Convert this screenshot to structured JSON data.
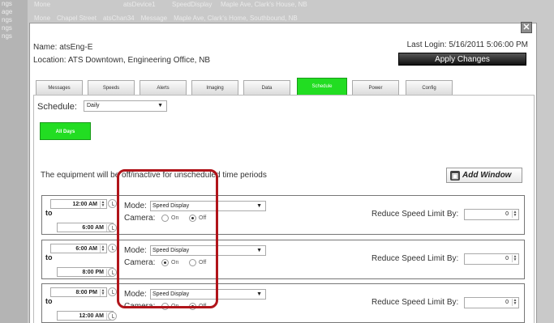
{
  "background": {
    "sidebar_items": [
      "ngs",
      "age",
      "ngs",
      "ngs",
      "ngs"
    ],
    "rows": [
      [
        "Mone",
        "atsDevice1",
        "SpeedDisplay",
        "Maple Ave, Clark's House, NB"
      ],
      [
        "Mone",
        "Chapel Street",
        "atsChan34",
        "Message",
        "Maple Ave, Clark's Home, Southbound, NB"
      ]
    ]
  },
  "modal": {
    "close_label": "✕",
    "name_label": "Name:",
    "name_value": "atsEng-E",
    "location_label": "Location:",
    "location_value": "ATS Downtown, Engineering Office, NB",
    "last_login_label": "Last Login:",
    "last_login_value": "5/16/2011 5:06:00 PM",
    "apply_label": "Apply Changes",
    "tabs": [
      {
        "label": "Messages",
        "active": false
      },
      {
        "label": "Speeds",
        "active": false
      },
      {
        "label": "Alerts",
        "active": false
      },
      {
        "label": "Imaging",
        "active": false
      },
      {
        "label": "Data",
        "active": false
      },
      {
        "label": "Schedule",
        "active": true
      },
      {
        "label": "Power",
        "active": false
      },
      {
        "label": "Config",
        "active": false
      }
    ],
    "schedule_label": "Schedule:",
    "schedule_value": "Daily",
    "all_days_label": "All Days",
    "note": "The equipment will be off/inactive for unscheduled time periods",
    "add_window_label": "Add Window",
    "windows": [
      {
        "start": "12:00 AM",
        "end": "6:00 AM",
        "mode": "Speed Display",
        "camera": "off",
        "reduce_value": "0"
      },
      {
        "start": "6:00 AM",
        "end": "8:00 PM",
        "mode": "Speed Display",
        "camera": "on",
        "reduce_value": "0"
      },
      {
        "start": "8:00 PM",
        "end": "12:00 AM",
        "mode": "Speed Display",
        "camera": "off",
        "reduce_value": "0"
      }
    ],
    "to_label": "to",
    "mode_label": "Mode:",
    "camera_label": "Camera:",
    "on_label": "On",
    "off_label": "Off",
    "reduce_label": "Reduce Speed Limit By:"
  },
  "colors": {
    "active_tab": "#22dd22",
    "highlight": "#b0141a"
  }
}
